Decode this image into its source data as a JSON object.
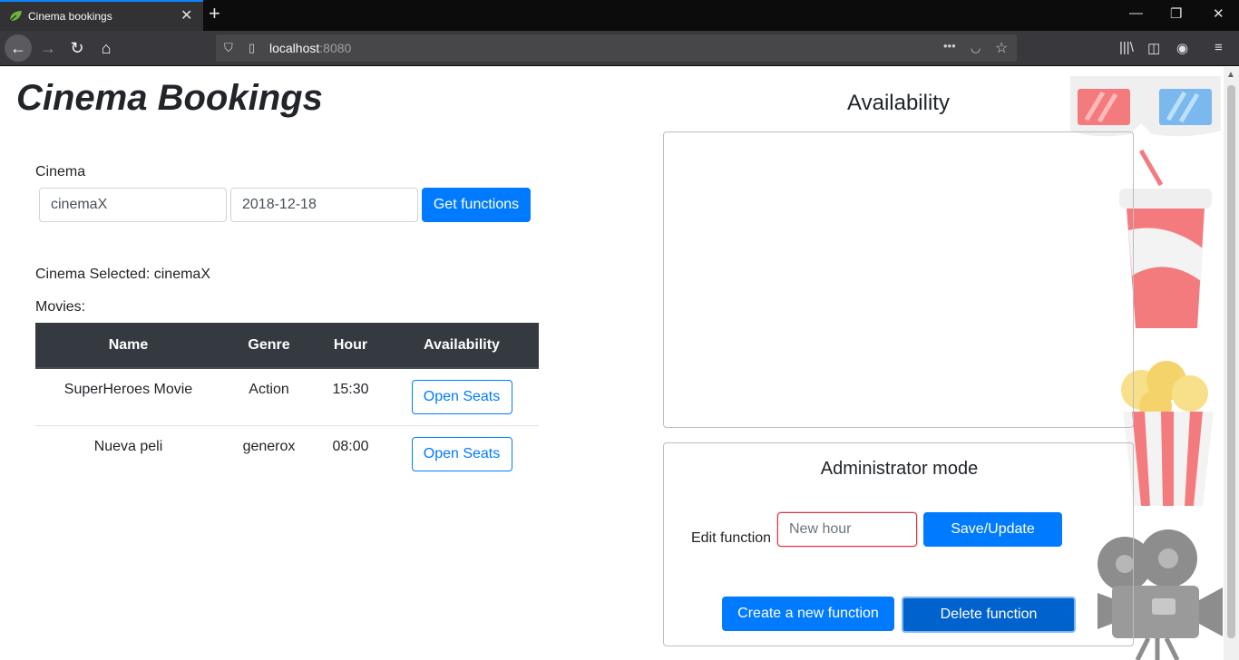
{
  "browser": {
    "tab_title": "Cinema bookings",
    "url_host": "localhost",
    "url_port": ":8080"
  },
  "page": {
    "brand": "Cinema Bookings",
    "cinema_label": "Cinema",
    "cinema_value": "cinemaX",
    "date_value": "2018-12-18",
    "get_functions_label": "Get functions",
    "cinema_selected_text": "Cinema Selected: cinemaX",
    "movies_label": "Movies:",
    "table": {
      "headers": [
        "Name",
        "Genre",
        "Hour",
        "Availability"
      ],
      "rows": [
        {
          "name": "SuperHeroes Movie",
          "genre": "Action",
          "hour": "15:30",
          "action": "Open Seats"
        },
        {
          "name": "Nueva peli",
          "genre": "generox",
          "hour": "08:00",
          "action": "Open Seats"
        }
      ]
    },
    "availability_title": "Availability",
    "admin": {
      "title": "Administrator mode",
      "edit_label": "Edit function",
      "hour_placeholder": "New hour",
      "save_label": "Save/Update",
      "create_label": "Create a new function",
      "delete_label": "Delete function"
    }
  },
  "colors": {
    "primary": "#007bff",
    "table_header": "#343a40",
    "invalid_border": "#dc3545"
  }
}
